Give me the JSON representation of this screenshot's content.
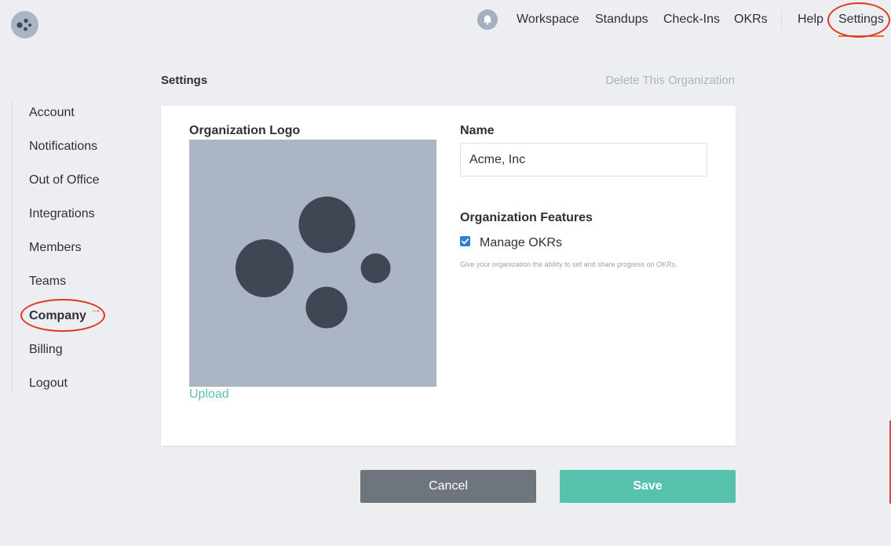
{
  "nav": {
    "workspace": "Workspace",
    "standups": "Standups",
    "checkins": "Check-Ins",
    "okrs": "OKRs",
    "help": "Help",
    "settings": "Settings"
  },
  "sidebar": {
    "items": [
      {
        "label": "Account"
      },
      {
        "label": "Notifications"
      },
      {
        "label": "Out of Office"
      },
      {
        "label": "Integrations"
      },
      {
        "label": "Members"
      },
      {
        "label": "Teams"
      },
      {
        "label": "Company"
      },
      {
        "label": "Billing"
      },
      {
        "label": "Logout"
      }
    ],
    "active": "Company",
    "active_arrow": "→"
  },
  "header": {
    "title": "Settings",
    "delete_link": "Delete This Organization"
  },
  "card": {
    "logo_label": "Organization Logo",
    "upload_label": "Upload",
    "name_label": "Name",
    "name_value": "Acme, Inc",
    "features_label": "Organization Features",
    "feature_okrs_label": "Manage OKRs",
    "feature_okrs_checked": true,
    "feature_okrs_help": "Give your organization the ability to set and share progress on OKRs."
  },
  "buttons": {
    "cancel": "Cancel",
    "save": "Save"
  },
  "icons": {
    "app_logo": "dots-logo-icon",
    "notifications": "bell-icon",
    "checkbox": "check-icon",
    "org_logo_placeholder": "dots-logo-icon"
  },
  "colors": {
    "accent": "#56c2ae",
    "active_indicator": "#e8732b",
    "annotation": "#e0361f",
    "checkbox": "#2f7fd4",
    "cancel": "#6f757d"
  }
}
